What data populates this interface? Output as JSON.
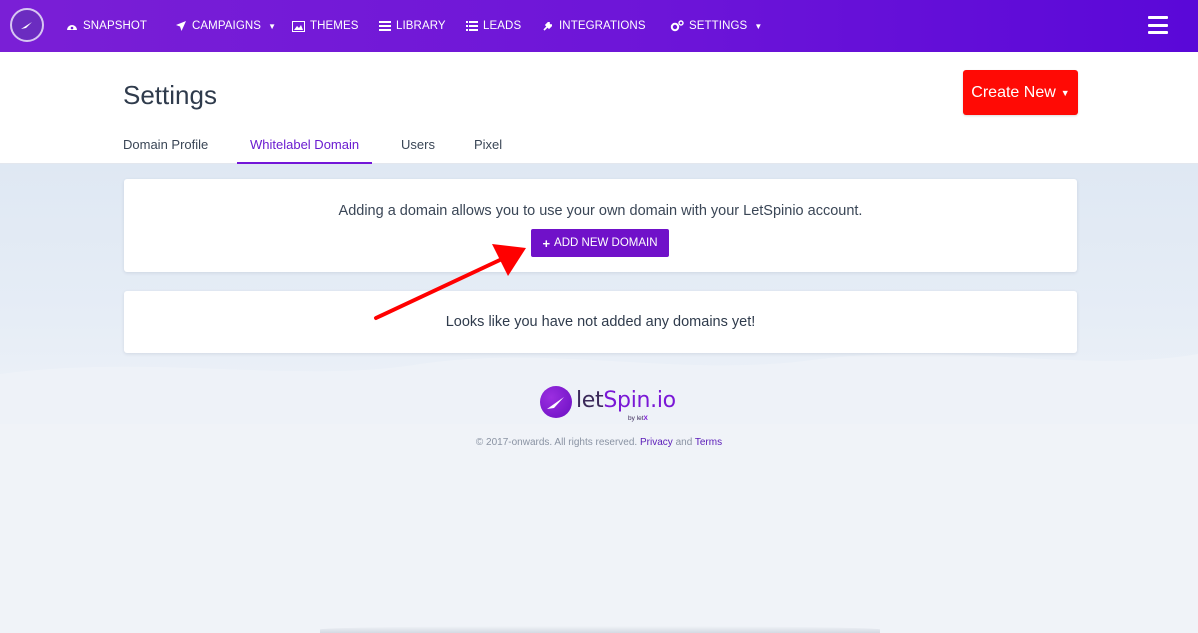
{
  "nav": {
    "items": [
      {
        "label": "SNAPSHOT",
        "icon": "dashboard-icon"
      },
      {
        "label": "CAMPAIGNS",
        "icon": "paper-plane-icon",
        "dropdown": true
      },
      {
        "label": "THEMES",
        "icon": "image-icon"
      },
      {
        "label": "LIBRARY",
        "icon": "tasks-icon"
      },
      {
        "label": "LEADS",
        "icon": "list-icon"
      },
      {
        "label": "INTEGRATIONS",
        "icon": "plug-icon"
      },
      {
        "label": "SETTINGS",
        "icon": "cogs-icon",
        "dropdown": true
      }
    ],
    "menu_icon": "hamburger-icon",
    "accent": "#6d15d8"
  },
  "header": {
    "title": "Settings",
    "create_new_label": "Create New",
    "create_new_color": "#ff0a05"
  },
  "tabs": [
    {
      "label": "Domain Profile"
    },
    {
      "label": "Whitelabel Domain",
      "active": true
    },
    {
      "label": "Users"
    },
    {
      "label": "Pixel"
    }
  ],
  "info_card": {
    "text": "Adding a domain allows you to use your own domain with your LetSpinio account.",
    "button_label": "ADD NEW DOMAIN",
    "button_color": "#7011c9"
  },
  "empty_card": {
    "text": "Looks like you have not added any domains yet!"
  },
  "footer": {
    "logo_text_main": "let",
    "logo_text_accent": "Spin.io",
    "logo_byline_prefix": "by let",
    "logo_byline_accent": "X",
    "copyright": "© 2017-onwards. All rights reserved.",
    "privacy_label": "Privacy",
    "and_text": "and",
    "terms_label": "Terms"
  },
  "annotation": {
    "arrow_color": "#ff0000"
  }
}
